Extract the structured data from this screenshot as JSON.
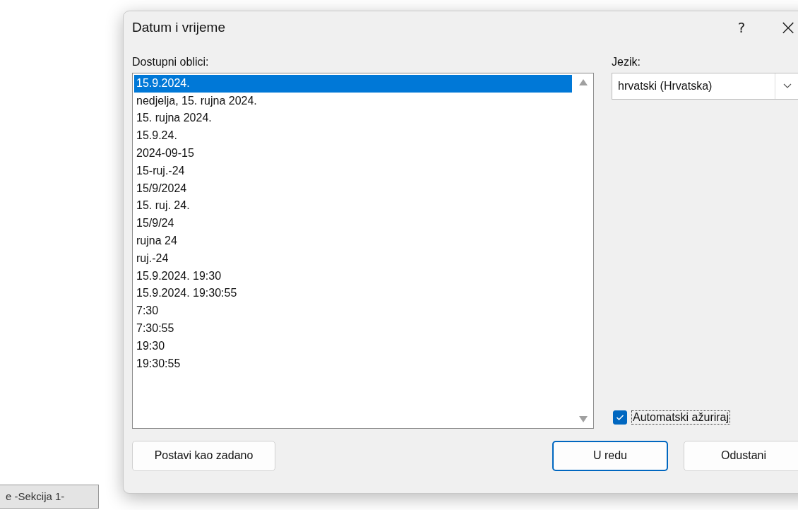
{
  "document": {
    "section_tag": "e -Sekcija 1-"
  },
  "dialog": {
    "title": "Datum i vrijeme",
    "help": "?",
    "close": "×",
    "formats": {
      "label": "Dostupni oblici:",
      "items": [
        {
          "text": "15.9.2024.",
          "selected": true
        },
        {
          "text": "nedjelja, 15. rujna 2024.",
          "selected": false
        },
        {
          "text": "15. rujna 2024.",
          "selected": false
        },
        {
          "text": "15.9.24.",
          "selected": false
        },
        {
          "text": "2024-09-15",
          "selected": false
        },
        {
          "text": "15-ruj.-24",
          "selected": false
        },
        {
          "text": "15/9/2024",
          "selected": false
        },
        {
          "text": "15. ruj. 24.",
          "selected": false
        },
        {
          "text": "15/9/24",
          "selected": false
        },
        {
          "text": "rujna 24",
          "selected": false
        },
        {
          "text": "ruj.-24",
          "selected": false
        },
        {
          "text": "15.9.2024. 19:30",
          "selected": false
        },
        {
          "text": "15.9.2024. 19:30:55",
          "selected": false
        },
        {
          "text": "7:30",
          "selected": false
        },
        {
          "text": "7:30:55",
          "selected": false
        },
        {
          "text": "19:30",
          "selected": false
        },
        {
          "text": "19:30:55",
          "selected": false
        }
      ]
    },
    "language": {
      "label": "Jezik:",
      "value": "hrvatski (Hrvatska)"
    },
    "auto_update": {
      "label": "Automatski ažuriraj",
      "checked": true
    },
    "buttons": [
      {
        "label": "Postavi kao zadano",
        "kind": "secondary"
      },
      {
        "label": "U redu",
        "kind": "default"
      },
      {
        "label": "Odustani",
        "kind": "normal"
      }
    ]
  }
}
